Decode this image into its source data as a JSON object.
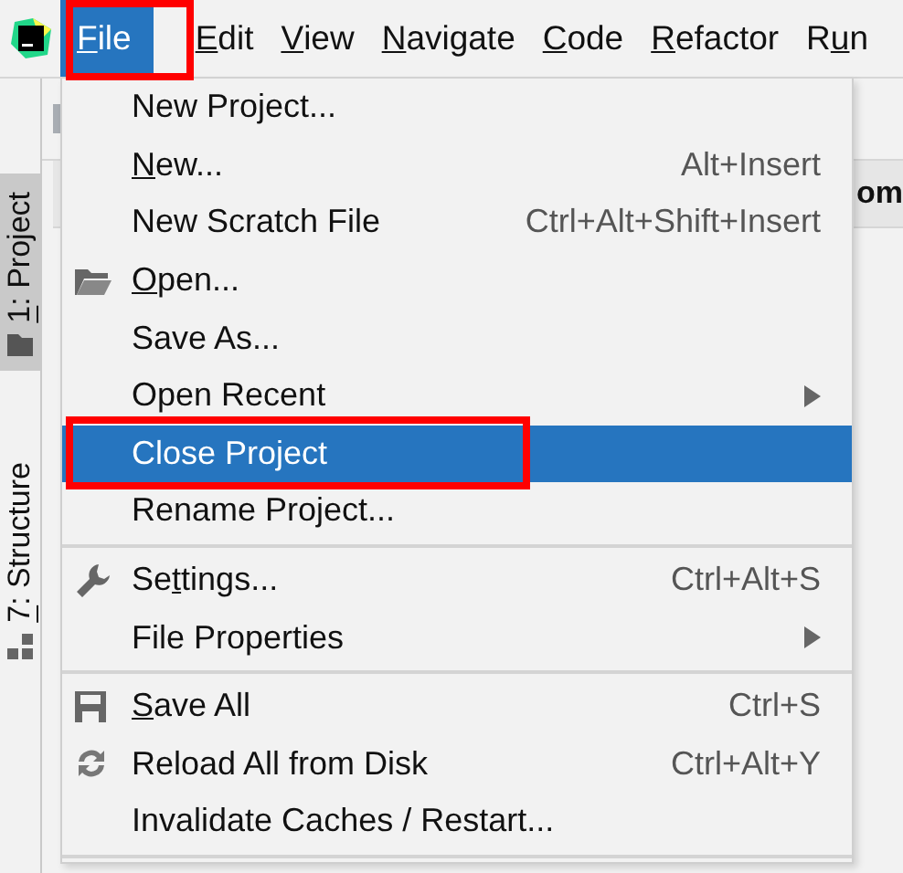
{
  "menubar": [
    {
      "key": "F",
      "post": "ile",
      "selected": true,
      "annotated": true
    },
    {
      "key": "E",
      "post": "dit",
      "selected": false,
      "annotated": false
    },
    {
      "key": "V",
      "post": "iew",
      "selected": false,
      "annotated": false
    },
    {
      "key": "N",
      "post": "avigate",
      "selected": false,
      "annotated": false
    },
    {
      "key": "C",
      "post": "ode",
      "selected": false,
      "annotated": false
    },
    {
      "key": "R",
      "post": "efactor",
      "selected": false,
      "annotated": false
    },
    {
      "pre": "R",
      "key": "u",
      "post": "n",
      "selected": false,
      "annotated": false
    }
  ],
  "side_tabs": [
    {
      "key": "1",
      "post": ": Project",
      "selected": true
    },
    {
      "key": "7",
      "post": ": Structure",
      "selected": false
    }
  ],
  "editor_tab_fragment": "om",
  "file_menu": [
    {
      "kind": "item",
      "post": "New Project...",
      "selected": false,
      "annotated": false
    },
    {
      "kind": "item",
      "key": "N",
      "post": "ew...",
      "shortcut": "Alt+Insert",
      "selected": false,
      "annotated": false
    },
    {
      "kind": "item",
      "post": "New Scratch File",
      "shortcut": "Ctrl+Alt+Shift+Insert",
      "selected": false,
      "annotated": false
    },
    {
      "kind": "item",
      "key": "O",
      "post": "pen...",
      "selected": false,
      "annotated": false
    },
    {
      "kind": "item",
      "post": "Save As...",
      "selected": false,
      "annotated": false
    },
    {
      "kind": "submenu",
      "post": "Open Recent",
      "selected": false,
      "annotated": false
    },
    {
      "kind": "item",
      "post": "Close Project",
      "selected": true,
      "annotated": true
    },
    {
      "kind": "item",
      "post": "Rename Project...",
      "selected": false,
      "annotated": false
    },
    {
      "kind": "separator"
    },
    {
      "kind": "item",
      "pre": "Se",
      "key": "t",
      "post": "tings...",
      "shortcut": "Ctrl+Alt+S",
      "selected": false,
      "annotated": false
    },
    {
      "kind": "submenu",
      "post": "File Properties",
      "selected": false,
      "annotated": false
    },
    {
      "kind": "separator"
    },
    {
      "kind": "item",
      "key": "S",
      "post": "ave All",
      "shortcut": "Ctrl+S",
      "selected": false,
      "annotated": false
    },
    {
      "kind": "item",
      "post": "Reload All from Disk",
      "shortcut": "Ctrl+Alt+Y",
      "selected": false,
      "annotated": false
    },
    {
      "kind": "item",
      "post": "Invalidate Caches / Restart...",
      "selected": false,
      "annotated": false
    },
    {
      "kind": "separator"
    }
  ]
}
